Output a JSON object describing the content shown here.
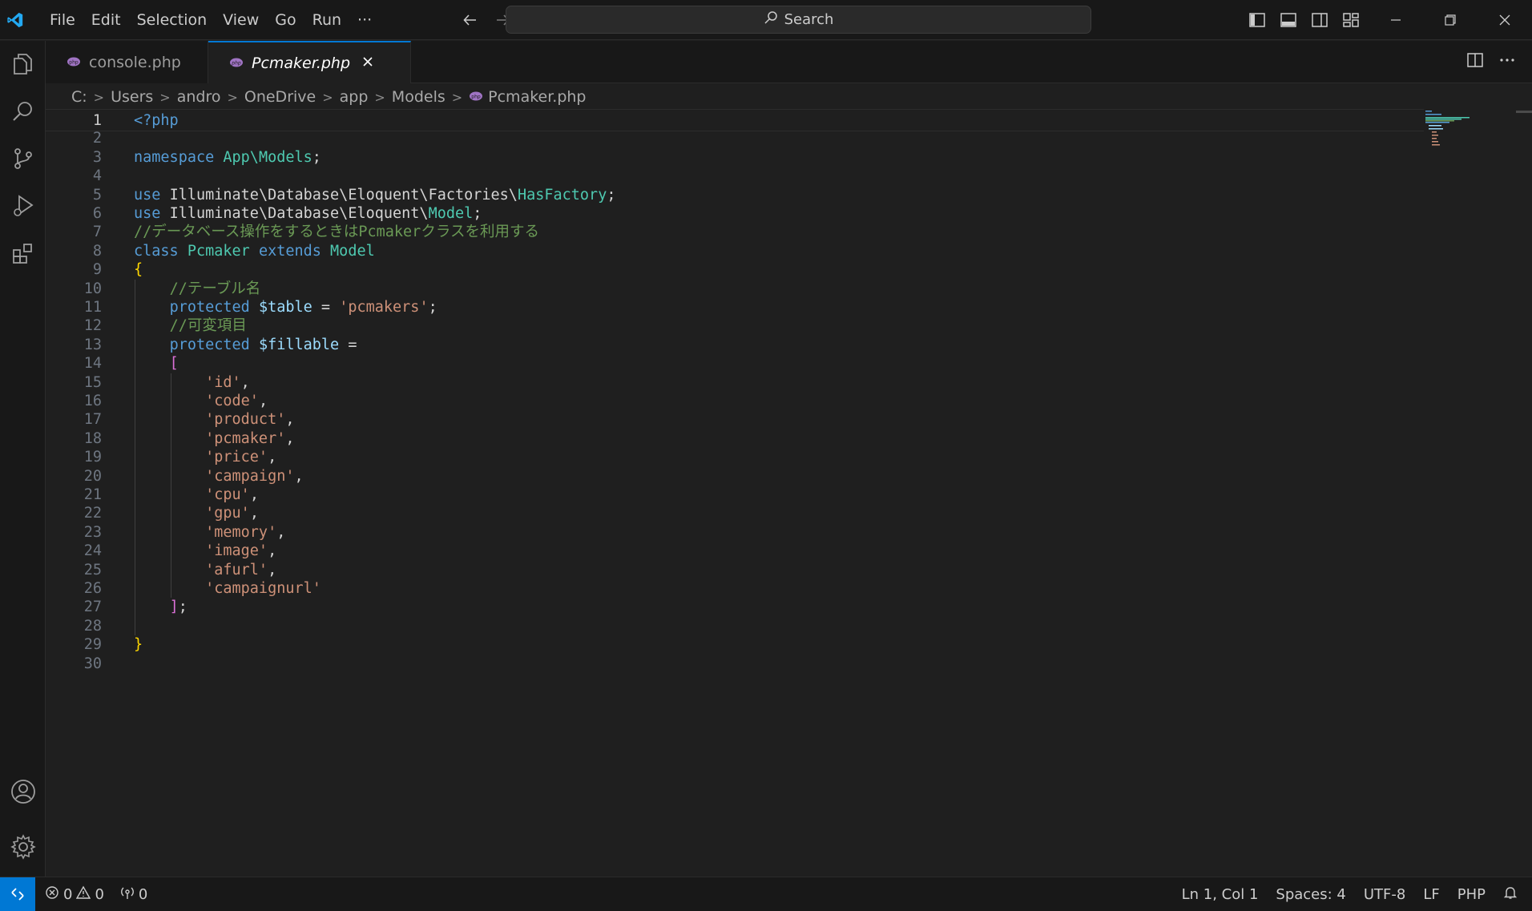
{
  "menu": {
    "items": [
      "File",
      "Edit",
      "Selection",
      "View",
      "Go",
      "Run"
    ],
    "more": "···"
  },
  "search": {
    "label": "Search"
  },
  "tabs": [
    {
      "label": "console.php",
      "active": false
    },
    {
      "label": "Pcmaker.php",
      "active": true
    }
  ],
  "breadcrumb": [
    "C:",
    "Users",
    "andro",
    "OneDrive",
    "app",
    "Models",
    "Pcmaker.php"
  ],
  "editor": {
    "lines": [
      {
        "n": "1",
        "t": [
          [
            "tagc",
            "<?php"
          ]
        ]
      },
      {
        "n": "2",
        "t": []
      },
      {
        "n": "3",
        "t": [
          [
            "kw",
            "namespace "
          ],
          [
            "ns",
            "App\\Models"
          ],
          [
            "wh",
            ";"
          ]
        ]
      },
      {
        "n": "4",
        "t": []
      },
      {
        "n": "5",
        "t": [
          [
            "kw",
            "use "
          ],
          [
            "wh",
            "Illuminate\\Database\\Eloquent\\Factories\\"
          ],
          [
            "ns",
            "HasFactory"
          ],
          [
            "wh",
            ";"
          ]
        ]
      },
      {
        "n": "6",
        "t": [
          [
            "kw",
            "use "
          ],
          [
            "wh",
            "Illuminate\\Database\\Eloquent\\"
          ],
          [
            "ns",
            "Model"
          ],
          [
            "wh",
            ";"
          ]
        ]
      },
      {
        "n": "7",
        "t": [
          [
            "cm",
            "//データベース操作をするときはPcmakerクラスを利用する"
          ]
        ]
      },
      {
        "n": "8",
        "t": [
          [
            "kw",
            "class "
          ],
          [
            "ns",
            "Pcmaker "
          ],
          [
            "kw",
            "extends "
          ],
          [
            "ns",
            "Model"
          ]
        ]
      },
      {
        "n": "9",
        "t": [
          [
            "br1",
            "{"
          ]
        ]
      },
      {
        "n": "10",
        "t": [
          [
            "wh",
            "    "
          ],
          [
            "cm",
            "//テーブル名"
          ]
        ]
      },
      {
        "n": "11",
        "t": [
          [
            "wh",
            "    "
          ],
          [
            "kw",
            "protected "
          ],
          [
            "var",
            "$table "
          ],
          [
            "wh",
            "= "
          ],
          [
            "str",
            "'pcmakers'"
          ],
          [
            "wh",
            ";"
          ]
        ]
      },
      {
        "n": "12",
        "t": [
          [
            "wh",
            "    "
          ],
          [
            "cm",
            "//可変項目"
          ]
        ]
      },
      {
        "n": "13",
        "t": [
          [
            "wh",
            "    "
          ],
          [
            "kw",
            "protected "
          ],
          [
            "var",
            "$fillable "
          ],
          [
            "wh",
            "="
          ]
        ]
      },
      {
        "n": "14",
        "t": [
          [
            "wh",
            "    "
          ],
          [
            "br2",
            "["
          ]
        ]
      },
      {
        "n": "15",
        "t": [
          [
            "wh",
            "        "
          ],
          [
            "str",
            "'id'"
          ],
          [
            "wh",
            ","
          ]
        ]
      },
      {
        "n": "16",
        "t": [
          [
            "wh",
            "        "
          ],
          [
            "str",
            "'code'"
          ],
          [
            "wh",
            ","
          ]
        ]
      },
      {
        "n": "17",
        "t": [
          [
            "wh",
            "        "
          ],
          [
            "str",
            "'product'"
          ],
          [
            "wh",
            ","
          ]
        ]
      },
      {
        "n": "18",
        "t": [
          [
            "wh",
            "        "
          ],
          [
            "str",
            "'pcmaker'"
          ],
          [
            "wh",
            ","
          ]
        ]
      },
      {
        "n": "19",
        "t": [
          [
            "wh",
            "        "
          ],
          [
            "str",
            "'price'"
          ],
          [
            "wh",
            ","
          ]
        ]
      },
      {
        "n": "20",
        "t": [
          [
            "wh",
            "        "
          ],
          [
            "str",
            "'campaign'"
          ],
          [
            "wh",
            ","
          ]
        ]
      },
      {
        "n": "21",
        "t": [
          [
            "wh",
            "        "
          ],
          [
            "str",
            "'cpu'"
          ],
          [
            "wh",
            ","
          ]
        ]
      },
      {
        "n": "22",
        "t": [
          [
            "wh",
            "        "
          ],
          [
            "str",
            "'gpu'"
          ],
          [
            "wh",
            ","
          ]
        ]
      },
      {
        "n": "23",
        "t": [
          [
            "wh",
            "        "
          ],
          [
            "str",
            "'memory'"
          ],
          [
            "wh",
            ","
          ]
        ]
      },
      {
        "n": "24",
        "t": [
          [
            "wh",
            "        "
          ],
          [
            "str",
            "'image'"
          ],
          [
            "wh",
            ","
          ]
        ]
      },
      {
        "n": "25",
        "t": [
          [
            "wh",
            "        "
          ],
          [
            "str",
            "'afurl'"
          ],
          [
            "wh",
            ","
          ]
        ]
      },
      {
        "n": "26",
        "t": [
          [
            "wh",
            "        "
          ],
          [
            "str",
            "'campaignurl'"
          ]
        ]
      },
      {
        "n": "27",
        "t": [
          [
            "wh",
            "    "
          ],
          [
            "br2",
            "]"
          ],
          [
            "wh",
            ";"
          ]
        ]
      },
      {
        "n": "28",
        "t": []
      },
      {
        "n": "29",
        "t": [
          [
            "br1",
            "}"
          ]
        ]
      },
      {
        "n": "30",
        "t": []
      }
    ]
  },
  "status": {
    "errors": "0",
    "warnings": "0",
    "ports": "0",
    "cursor": "Ln 1, Col 1",
    "spaces": "Spaces: 4",
    "encoding": "UTF-8",
    "eol": "LF",
    "language": "PHP"
  },
  "colors": {
    "accent": "#0078d4",
    "php_icon": "#a074c4"
  }
}
